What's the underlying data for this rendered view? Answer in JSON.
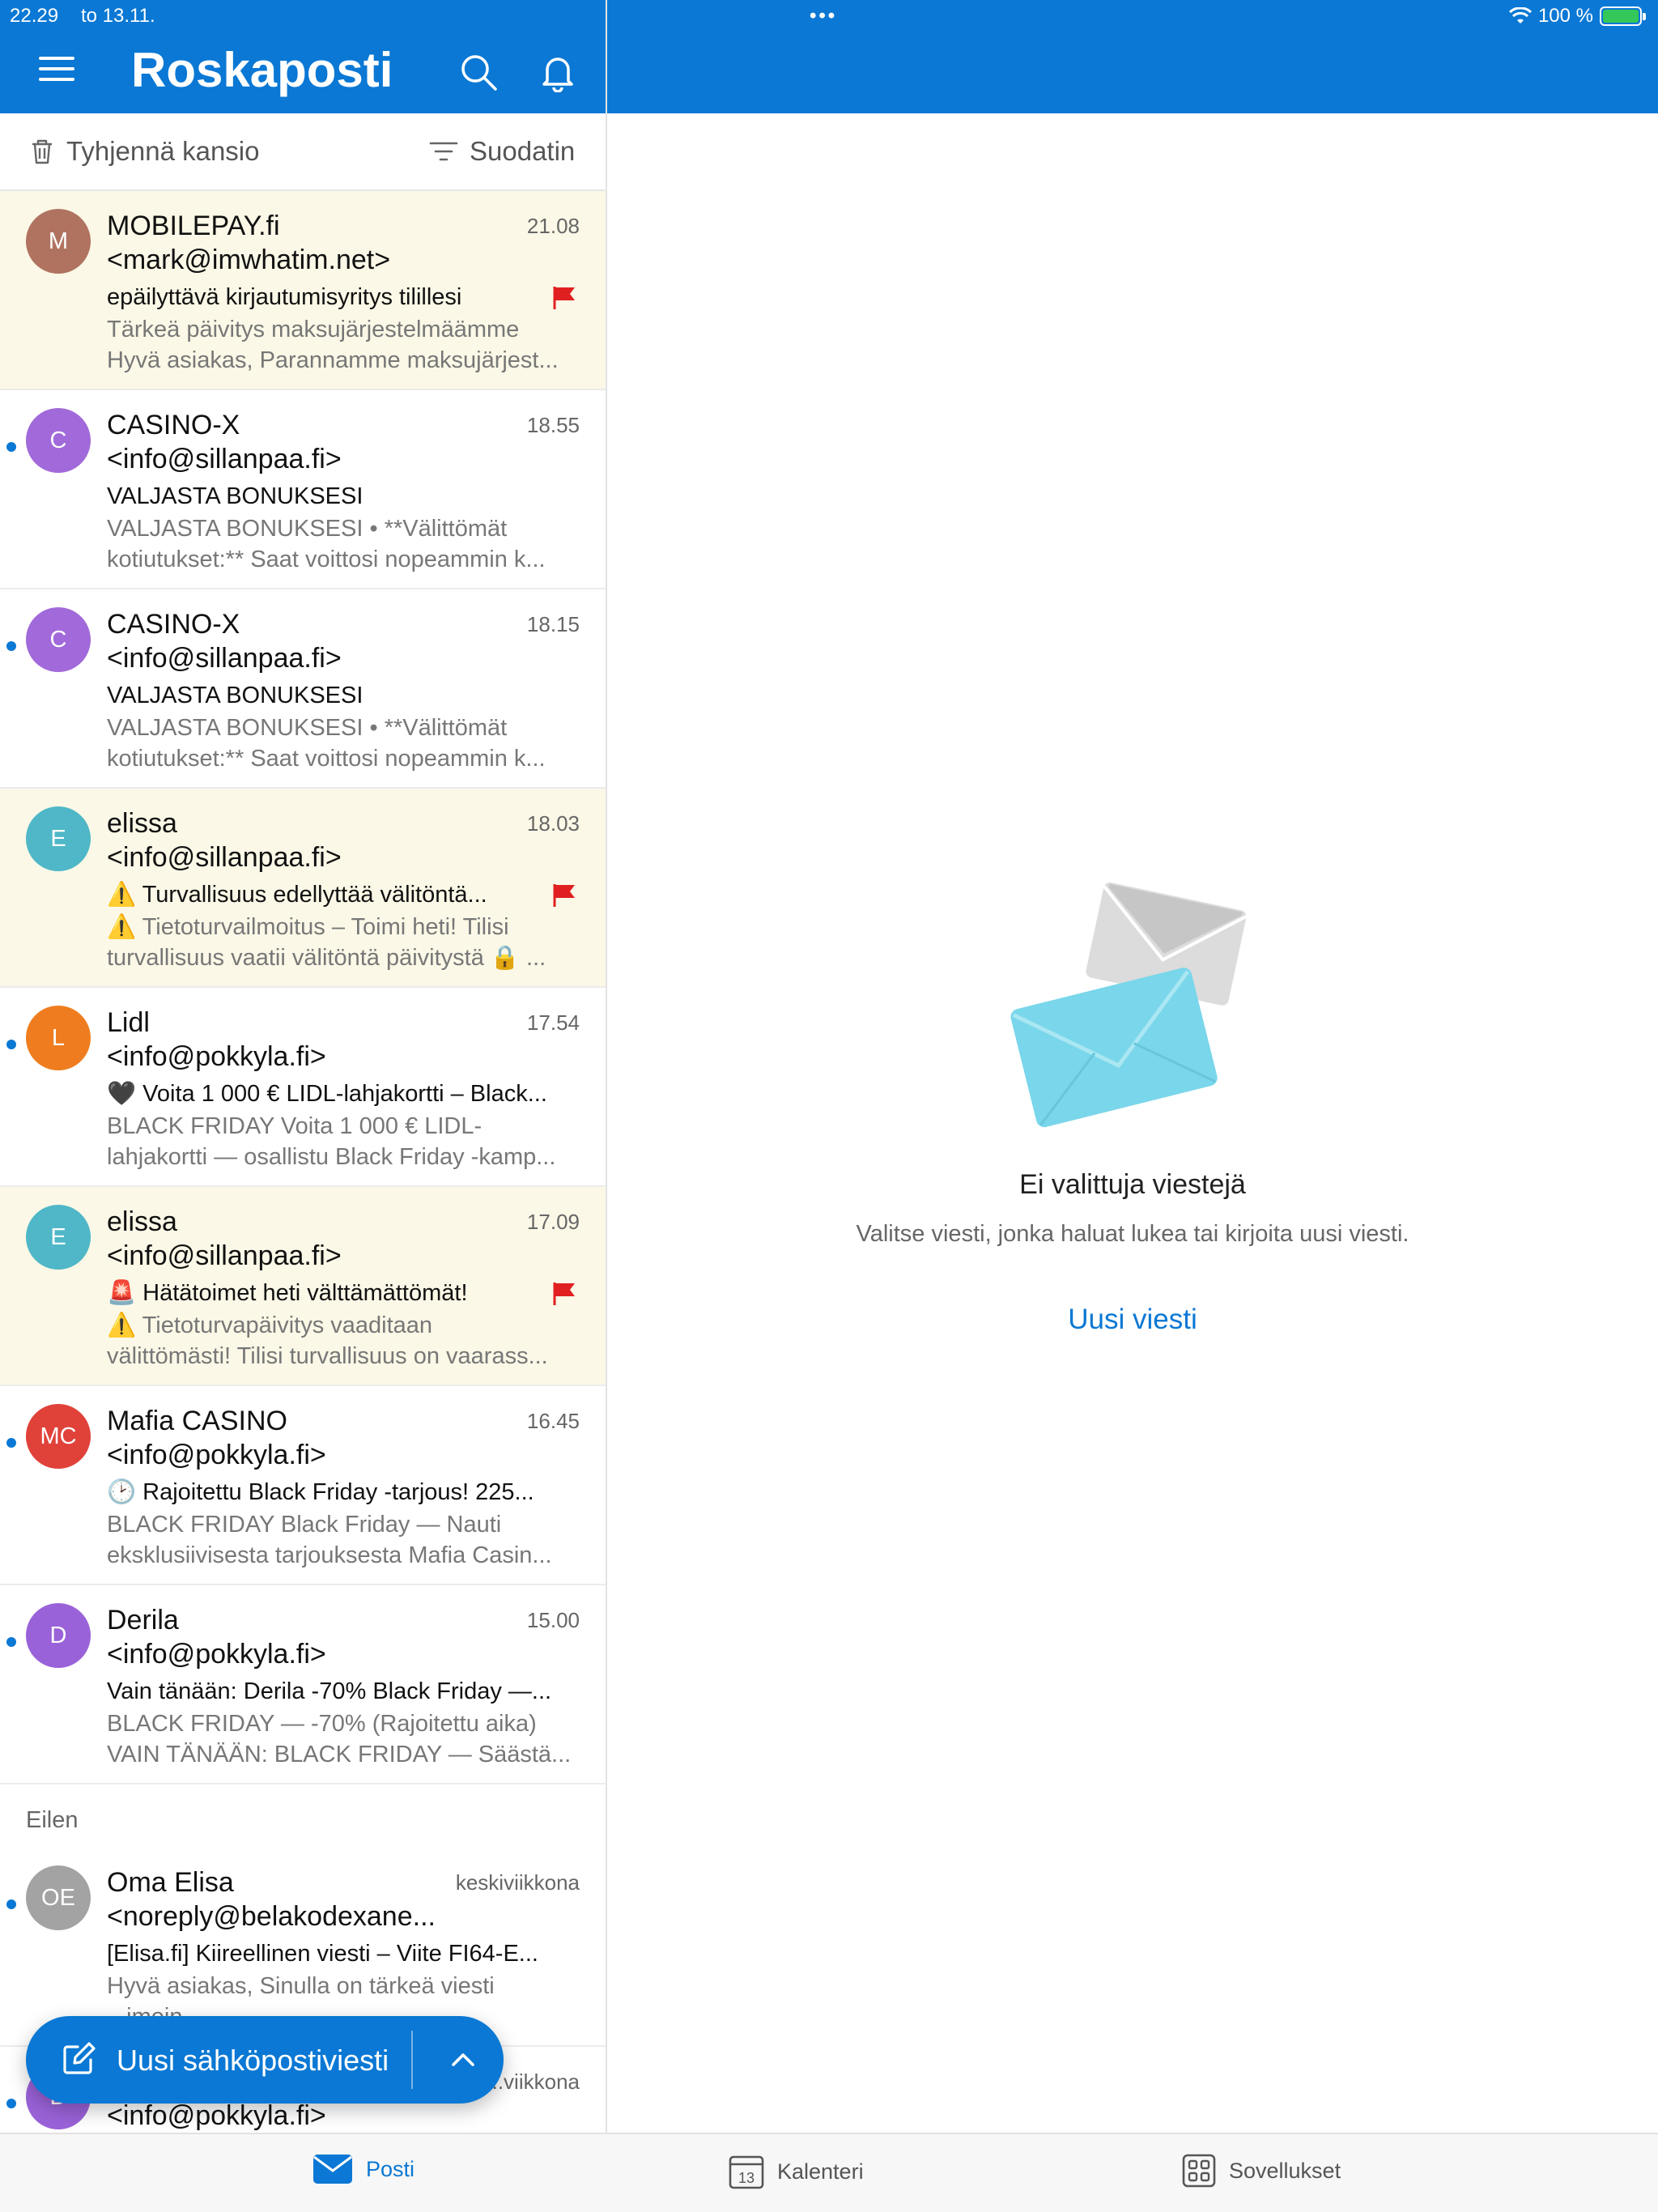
{
  "status_bar": {
    "time": "22.29",
    "date": "to 13.11.",
    "battery": "100 %"
  },
  "header": {
    "title": "Roskaposti"
  },
  "toolbar": {
    "empty_folder": "Tyhjennä kansio",
    "filter": "Suodatin"
  },
  "messages": [
    {
      "initials": "M",
      "avatar_color": "#b07360",
      "sender": "MOBILEPAY.fi",
      "email": "<mark@imwhatim.net>",
      "time": "21.08",
      "subject": "epäilyttävä kirjautumisyritys tilillesi",
      "preview1": "Tärkeä päivitys maksujärjestelmäämme",
      "preview2": "Hyvä asiakas, Parannamme maksujärjest...",
      "flagged": true,
      "unread": false
    },
    {
      "initials": "C",
      "avatar_color": "#a169d9",
      "sender": "CASINO-X",
      "email": "<info@sillanpaa.fi>",
      "time": "18.55",
      "subject": "VALJASTA BONUKSESI",
      "preview1": "VALJASTA BONUKSESI • **Välittömät",
      "preview2": "kotiutukset:** Saat voittosi nopeammin k...",
      "flagged": false,
      "unread": true
    },
    {
      "initials": "C",
      "avatar_color": "#a169d9",
      "sender": "CASINO-X",
      "email": "<info@sillanpaa.fi>",
      "time": "18.15",
      "subject": "VALJASTA BONUKSESI",
      "preview1": "VALJASTA BONUKSESI • **Välittömät",
      "preview2": "kotiutukset:** Saat voittosi nopeammin k...",
      "flagged": false,
      "unread": true
    },
    {
      "initials": "E",
      "avatar_color": "#4fb7c7",
      "sender": "elissa",
      "email": "<info@sillanpaa.fi>",
      "time": "18.03",
      "subject": "⚠️ Turvallisuus edellyttää välitöntä...",
      "preview1": "⚠️ Tietoturvailmoitus – Toimi heti! Tilisi",
      "preview2": "turvallisuus vaatii välitöntä päivitystä 🔒 ...",
      "flagged": true,
      "unread": false
    },
    {
      "initials": "L",
      "avatar_color": "#ef7d1f",
      "sender": "Lidl",
      "email": "<info@pokkyla.fi>",
      "time": "17.54",
      "subject": "🖤 Voita 1 000 € LIDL-lahjakortti – Black...",
      "preview1": "BLACK FRIDAY Voita 1 000 € LIDL-",
      "preview2": "lahjakortti — osallistu Black Friday -kamp...",
      "flagged": false,
      "unread": true
    },
    {
      "initials": "E",
      "avatar_color": "#4fb7c7",
      "sender": "elissa",
      "email": "<info@sillanpaa.fi>",
      "time": "17.09",
      "subject": "🚨 Hätätoimet heti välttämättömät!",
      "preview1": "⚠️ Tietoturvapäivitys vaaditaan",
      "preview2": "välittömästi! Tilisi turvallisuus on vaarass...",
      "flagged": true,
      "unread": false
    },
    {
      "initials": "MC",
      "avatar_color": "#e0423a",
      "sender": "Mafia CASINO",
      "email": "<info@pokkyla.fi>",
      "time": "16.45",
      "subject": "🕑 Rajoitettu Black Friday -tarjous! 225...",
      "preview1": "BLACK FRIDAY Black Friday — Nauti",
      "preview2": "eksklusiivisesta tarjouksesta Mafia Casin...",
      "flagged": false,
      "unread": true
    },
    {
      "initials": "D",
      "avatar_color": "#9a62d8",
      "sender": "Derila",
      "email": "<info@pokkyla.fi>",
      "time": "15.00",
      "subject": "Vain tänään: Derila -70% Black Friday —...",
      "preview1": "BLACK FRIDAY — -70% (Rajoitettu aika)",
      "preview2": "VAIN TÄNÄÄN: BLACK FRIDAY — Säästä...",
      "flagged": false,
      "unread": true
    }
  ],
  "section_label": "Eilen",
  "yesterday_messages": [
    {
      "initials": "OE",
      "avatar_color": "#a3a3a3",
      "sender": "Oma Elisa",
      "email": "<noreply@belakodexane...",
      "time": "keskiviikkona",
      "subject": "[Elisa.fi] Kiireellinen viesti  – Viite FI64-E...",
      "preview1": "Hyvä asiakas, Sinulla on tärkeä viesti",
      "preview2": "...imein...",
      "flagged": false,
      "unread": true
    },
    {
      "initials": "D",
      "avatar_color": "#9a62d8",
      "sender": "",
      "email": "<info@pokkyla.fi>",
      "time": "...viikkona",
      "subject": "",
      "preview1": "",
      "preview2": "",
      "flagged": false,
      "unread": true
    }
  ],
  "fab": {
    "label": "Uusi sähköpostiviesti"
  },
  "empty_state": {
    "title": "Ei valittuja viestejä",
    "subtitle": "Valitse viesti, jonka haluat lukea tai kirjoita uusi viesti.",
    "link": "Uusi viesti"
  },
  "tabs": [
    {
      "label": "Posti",
      "icon": "mail-icon",
      "active": true
    },
    {
      "label": "Kalenteri",
      "icon": "calendar-icon",
      "calendar_day": "13",
      "active": false
    },
    {
      "label": "Sovellukset",
      "icon": "apps-icon",
      "active": false
    }
  ],
  "colors": {
    "brand_blue": "#0a78d4",
    "flag_red": "#e02020",
    "flagged_bg": "#fbf8e7"
  }
}
